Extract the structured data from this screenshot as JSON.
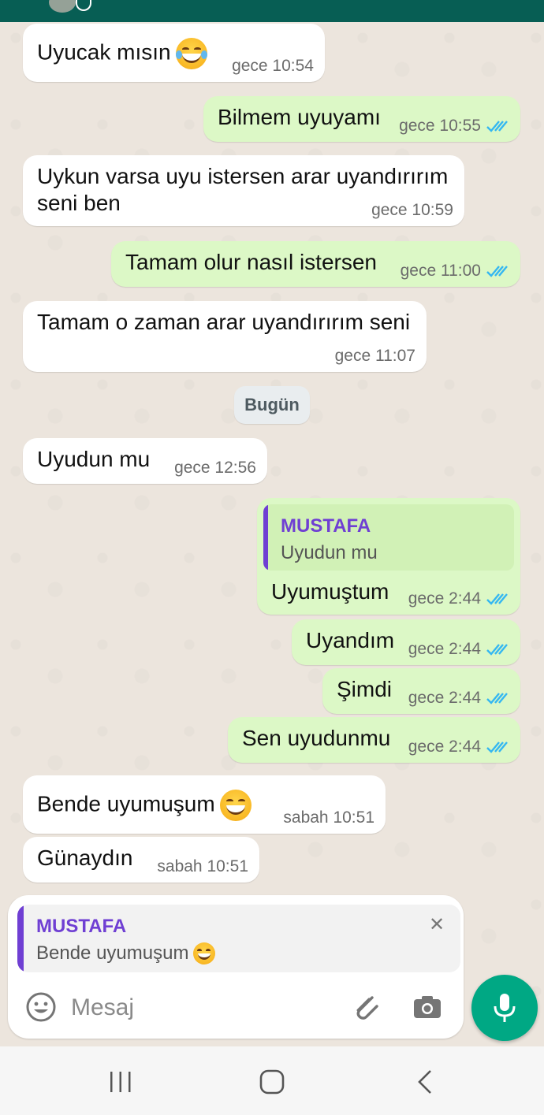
{
  "contact": {
    "name": "MUSTAFA"
  },
  "messages": [
    {
      "dir": "in",
      "text": "Uyucak mısın",
      "time": "gece 10:54",
      "emoji": "tears-of-joy"
    },
    {
      "dir": "out",
      "text": "Bilmem uyuyamı",
      "time": "gece 10:55",
      "read": true
    },
    {
      "dir": "in",
      "text_line1": "Uykun varsa uyu istersen arar uyandırırım",
      "text_line2": "seni ben",
      "time": "gece 10:59"
    },
    {
      "dir": "out",
      "text": "Tamam olur nasıl istersen",
      "time": "gece 11:00",
      "read": true
    },
    {
      "dir": "in",
      "text": "Tamam o zaman arar uyandırırım seni",
      "time": "gece 11:07"
    },
    {
      "dir": "in",
      "text": "Uyudun mu",
      "time": "gece 12:56"
    },
    {
      "dir": "out",
      "quote_name": "MUSTAFA",
      "quote_text": "Uyudun mu",
      "text": "Uyumuştum",
      "time": "gece 2:44",
      "read": true
    },
    {
      "dir": "out",
      "text": "Uyandım",
      "time": "gece 2:44",
      "read": true
    },
    {
      "dir": "out",
      "text": "Şimdi",
      "time": "gece 2:44",
      "read": true
    },
    {
      "dir": "out",
      "text": "Sen uyudunmu",
      "time": "gece 2:44",
      "read": true
    },
    {
      "dir": "in",
      "text": "Bende uyumuşum",
      "time": "sabah 10:51",
      "emoji": "grinning"
    },
    {
      "dir": "in",
      "text": "Günaydın",
      "time": "sabah 10:51"
    }
  ],
  "day_separator": "Bugün",
  "composer": {
    "reply_name": "MUSTAFA",
    "reply_text": "Bende uyumuşum",
    "placeholder": "Mesaj",
    "icons": [
      "emoji-icon",
      "attach-icon",
      "camera-icon",
      "mic-icon",
      "close-icon"
    ]
  },
  "navbar": {
    "icons": [
      "recent-apps-icon",
      "home-icon",
      "back-icon"
    ]
  },
  "colors": {
    "header": "#075e54",
    "outgoing": "#dcf8c6",
    "incoming": "#ffffff",
    "accent": "#00a884",
    "read_tick": "#34b7f1",
    "quote_bar": "#6f3fd3"
  }
}
